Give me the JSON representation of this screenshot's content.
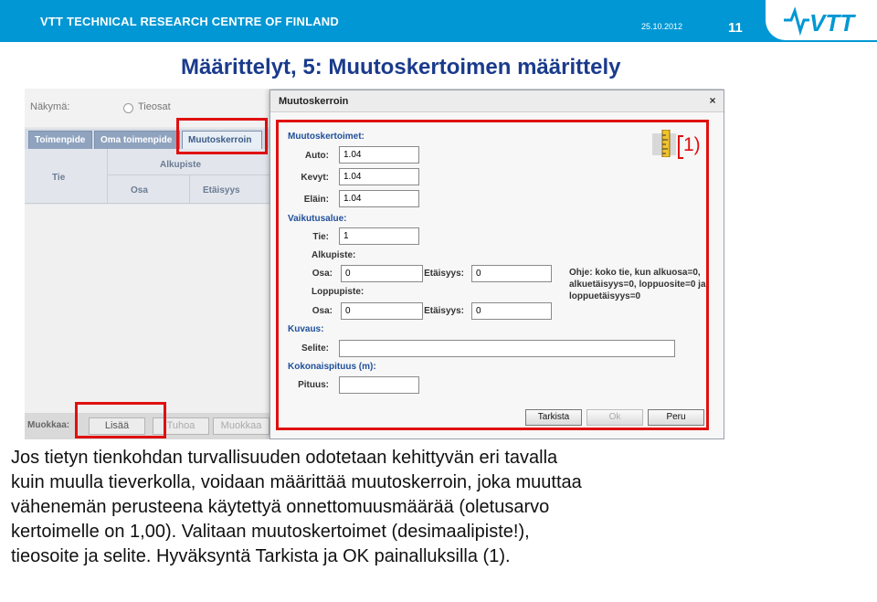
{
  "header": {
    "org": "VTT TECHNICAL RESEARCH CENTRE OF FINLAND",
    "date": "25.10.2012",
    "page_number": "11",
    "logo_text": "VTT",
    "bg_color": "#0097d4"
  },
  "slide_title": "Määrittelyt, 5: Muutoskertoimen määrittely",
  "app": {
    "view_label": "Näkymä:",
    "view_option": "Tieosat",
    "tabs": [
      "Toimenpide",
      "Oma toimenpide",
      "Muutoskerroin"
    ],
    "active_tab": "Muutoskerroin",
    "grid_headers": {
      "tie": "Tie",
      "alkupiste": "Alkupiste",
      "osa": "Osa",
      "etaisyys": "Etäisyys"
    },
    "bottom_bar": {
      "label": "Muokkaa:",
      "buttons": [
        "Lisää",
        "Tuhoa",
        "Muokkaa"
      ]
    }
  },
  "dialog": {
    "title": "Muutoskerroin",
    "close": "×",
    "sections": {
      "multipliers": "Muutoskertoimet:",
      "scope": "Vaikutusalue:",
      "description": "Kuvaus:",
      "total_length": "Kokonaispituus (m):"
    },
    "fields": {
      "auto_label": "Auto:",
      "auto_value": "1.04",
      "kevyt_label": "Kevyt:",
      "kevyt_value": "1.04",
      "elain_label": "Eläin:",
      "elain_value": "1.04",
      "tie_label": "Tie:",
      "tie_value": "1",
      "alkupiste_label": "Alkupiste:",
      "alku_osa_label": "Osa:",
      "alku_osa_value": "0",
      "alku_etaisyys_label": "Etäisyys:",
      "alku_etaisyys_value": "0",
      "loppupiste_label": "Loppupiste:",
      "loppu_osa_label": "Osa:",
      "loppu_osa_value": "0",
      "loppu_etaisyys_label": "Etäisyys:",
      "loppu_etaisyys_value": "0",
      "selite_label": "Selite:",
      "selite_value": "",
      "pituus_label": "Pituus:",
      "pituus_value": ""
    },
    "help": [
      "Ohje: koko tie, kun alkuosa=0,",
      "alkuetäisyys=0, loppuosite=0 ja",
      "loppuetäisyys=0"
    ],
    "buttons": {
      "check": "Tarkista",
      "ok": "Ok",
      "cancel": "Peru"
    }
  },
  "annotation": "1)",
  "body_lines": [
    "Jos tietyn tienkohdan turvallisuuden odotetaan kehittyvän eri tavalla",
    "kuin muulla tieverkolla, voidaan määrittää muutoskerroin, joka muuttaa",
    "vähenemän perusteena käytettyä onnettomuusmäärää (oletusarvo",
    "kertoimelle on 1,00). Valitaan muutoskertoimet (desimaalipiste!),",
    "tieosoite ja selite. Hyväksyntä Tarkista ja OK painalluksilla (1)."
  ]
}
